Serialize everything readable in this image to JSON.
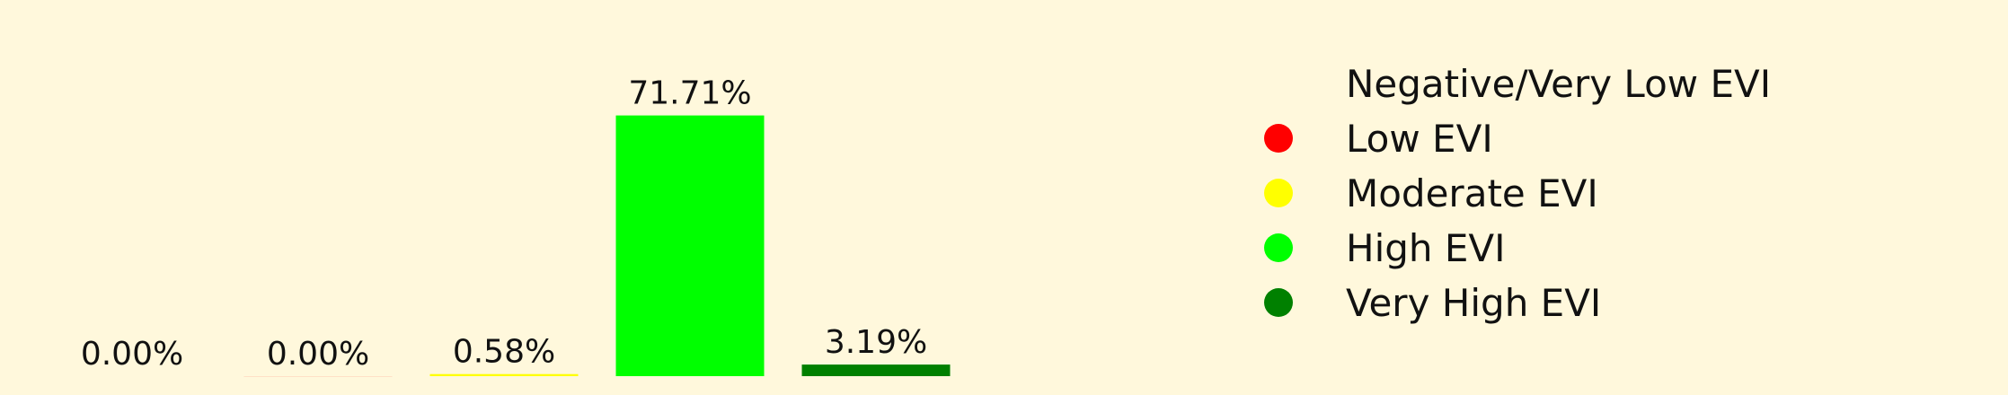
{
  "colors": {
    "background": "#fff8dc",
    "text": "#111111"
  },
  "chart_data": {
    "type": "bar",
    "categories": [
      "Negative/Very Low EVI",
      "Low EVI",
      "Moderate EVI",
      "High EVI",
      "Very High EVI"
    ],
    "values": [
      0.0,
      0.0,
      0.58,
      71.71,
      3.19
    ],
    "value_labels": [
      "0.00%",
      "0.00%",
      "0.58%",
      "71.71%",
      "3.19%"
    ],
    "colors": [
      "#fff8dc",
      "#ff0000",
      "#ffff00",
      "#00ff00",
      "#008000"
    ],
    "ylim": [
      0,
      80
    ],
    "grid": false,
    "legend": {
      "placement": "right",
      "entries": [
        {
          "label": "Negative/Very Low EVI",
          "color": "#fff8dc"
        },
        {
          "label": "Low EVI",
          "color": "#ff0000"
        },
        {
          "label": "Moderate EVI",
          "color": "#ffff00"
        },
        {
          "label": "High EVI",
          "color": "#00ff00"
        },
        {
          "label": "Very High EVI",
          "color": "#008000"
        }
      ]
    }
  }
}
